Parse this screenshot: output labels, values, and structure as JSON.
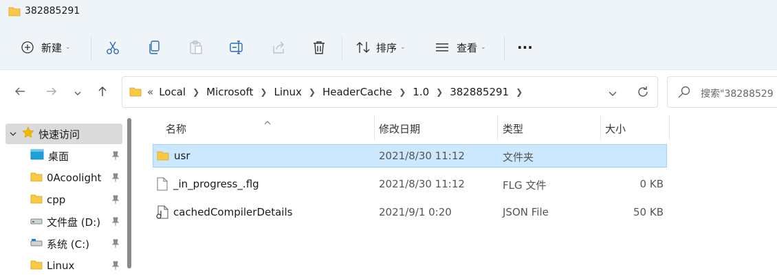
{
  "window": {
    "title": "382885291"
  },
  "toolbar": {
    "new_label": "新建",
    "sort_label": "排序",
    "view_label": "查看",
    "more_label": "···"
  },
  "address": {
    "overflow": "«",
    "crumbs": [
      "Local",
      "Microsoft",
      "Linux",
      "HeaderCache",
      "1.0",
      "382885291"
    ]
  },
  "search": {
    "placeholder": "搜索\"38288529"
  },
  "sidebar": {
    "items": [
      {
        "label": "快速访问",
        "icon": "star-icon"
      },
      {
        "label": "桌面",
        "icon": "desktop-icon"
      },
      {
        "label": "0Acoolight",
        "icon": "folder-icon"
      },
      {
        "label": "cpp",
        "icon": "folder-icon"
      },
      {
        "label": "文件盘 (D:)",
        "icon": "drive-icon"
      },
      {
        "label": "系统 (C:)",
        "icon": "drive-icon"
      },
      {
        "label": "Linux",
        "icon": "folder-icon"
      }
    ]
  },
  "columns": {
    "name": "名称",
    "modified": "修改日期",
    "type": "类型",
    "size": "大小"
  },
  "files": [
    {
      "name": "usr",
      "modified": "2021/8/30 11:12",
      "type": "文件夹",
      "size": "",
      "icon": "folder-icon",
      "selected": true
    },
    {
      "name": "_in_progress_.flg",
      "modified": "2021/8/30 11:12",
      "type": "FLG 文件",
      "size": "0 KB",
      "icon": "file-icon",
      "selected": false
    },
    {
      "name": "cachedCompilerDetails",
      "modified": "2021/9/1 0:20",
      "type": "JSON File",
      "size": "50 KB",
      "icon": "json-file-icon",
      "selected": false
    }
  ],
  "colors": {
    "accent": "#0067c0",
    "selection": "#cce8ff",
    "folder": "#f8c846"
  }
}
